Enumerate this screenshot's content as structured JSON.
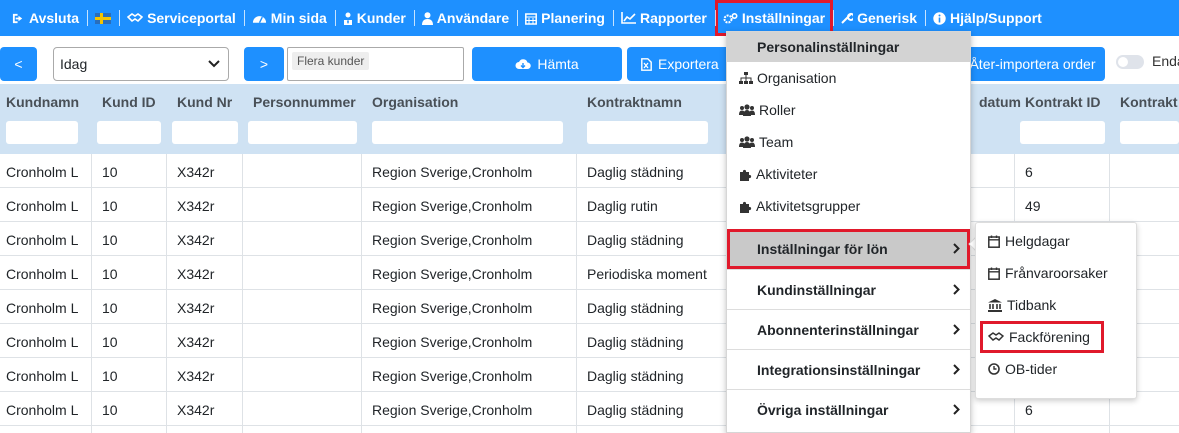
{
  "nav": {
    "items": [
      {
        "label": "Avsluta",
        "icon": "logout-icon"
      },
      {
        "label": "",
        "icon": "swedish-flag-icon"
      },
      {
        "label": "Serviceportal",
        "icon": "handshake-icon"
      },
      {
        "label": "Min sida",
        "icon": "dashboard-icon"
      },
      {
        "label": "Kunder",
        "icon": "user-tie-icon"
      },
      {
        "label": "Användare",
        "icon": "user-icon"
      },
      {
        "label": "Planering",
        "icon": "calendar-icon"
      },
      {
        "label": "Rapporter",
        "icon": "line-chart-icon"
      },
      {
        "label": "Inställningar",
        "icon": "gears-icon"
      },
      {
        "label": "Generisk",
        "icon": "wrench-icon"
      },
      {
        "label": "Hjälp/Support",
        "icon": "info-icon"
      }
    ]
  },
  "toolbar": {
    "prev": "<",
    "date_select": "Idag",
    "next": ">",
    "customers_placeholder": "Flera kunder",
    "fetch": "Hämta",
    "export": "Exportera",
    "reimport": "Åter-importera order",
    "toggle_label": "Enda"
  },
  "table": {
    "headers": [
      "Kundnamn",
      "Kund ID",
      "Kund Nr",
      "Personnummer",
      "Organisation",
      "Kontraktnamn",
      "datum",
      "Kontrakt ID",
      "Kontrakt"
    ],
    "rows": [
      {
        "kundnamn": "Cronholm L",
        "kund_id": "10",
        "kund_nr": "X342r",
        "org": "Region Sverige,Cronholm",
        "kontrakt": "Daglig städning",
        "kontrakt_id": "6"
      },
      {
        "kundnamn": "Cronholm L",
        "kund_id": "10",
        "kund_nr": "X342r",
        "org": "Region Sverige,Cronholm",
        "kontrakt": "Daglig rutin",
        "kontrakt_id": "49"
      },
      {
        "kundnamn": "Cronholm L",
        "kund_id": "10",
        "kund_nr": "X342r",
        "org": "Region Sverige,Cronholm",
        "kontrakt": "Daglig städning",
        "kontrakt_id": ""
      },
      {
        "kundnamn": "Cronholm L",
        "kund_id": "10",
        "kund_nr": "X342r",
        "org": "Region Sverige,Cronholm",
        "kontrakt": "Periodiska moment",
        "kontrakt_id": ""
      },
      {
        "kundnamn": "Cronholm L",
        "kund_id": "10",
        "kund_nr": "X342r",
        "org": "Region Sverige,Cronholm",
        "kontrakt": "Daglig städning",
        "kontrakt_id": ""
      },
      {
        "kundnamn": "Cronholm L",
        "kund_id": "10",
        "kund_nr": "X342r",
        "org": "Region Sverige,Cronholm",
        "kontrakt": "Daglig städning",
        "kontrakt_id": ""
      },
      {
        "kundnamn": "Cronholm L",
        "kund_id": "10",
        "kund_nr": "X342r",
        "org": "Region Sverige,Cronholm",
        "kontrakt": "Daglig städning",
        "kontrakt_id": ""
      },
      {
        "kundnamn": "Cronholm L",
        "kund_id": "10",
        "kund_nr": "X342r",
        "org": "Region Sverige,Cronholm",
        "kontrakt": "Daglig städning",
        "kontrakt_id": "6"
      }
    ]
  },
  "dropdown": {
    "header": "Personalinställningar",
    "items": [
      {
        "label": "Organisation",
        "icon": "sitemap-icon"
      },
      {
        "label": "Roller",
        "icon": "users-icon"
      },
      {
        "label": "Team",
        "icon": "users-icon"
      },
      {
        "label": "Aktiviteter",
        "icon": "puzzle-icon"
      },
      {
        "label": "Aktivitetsgrupper",
        "icon": "puzzle-icon"
      }
    ],
    "groups": [
      {
        "label": "Inställningar för lön"
      },
      {
        "label": "Kundinställningar"
      },
      {
        "label": "Abonnenterinställningar"
      },
      {
        "label": "Integrationsinställningar"
      },
      {
        "label": "Övriga inställningar"
      }
    ]
  },
  "submenu": {
    "items": [
      {
        "label": "Helgdagar",
        "icon": "calendar-icon"
      },
      {
        "label": "Frånvaroorsaker",
        "icon": "calendar-icon"
      },
      {
        "label": "Tidbank",
        "icon": "bank-icon"
      },
      {
        "label": "Fackförening",
        "icon": "handshake-icon"
      },
      {
        "label": "OB-tider",
        "icon": "clock-icon"
      }
    ]
  },
  "colors": {
    "primary": "#1e90ff",
    "highlight": "#e0192b",
    "header_bg": "#cfe2f3"
  }
}
